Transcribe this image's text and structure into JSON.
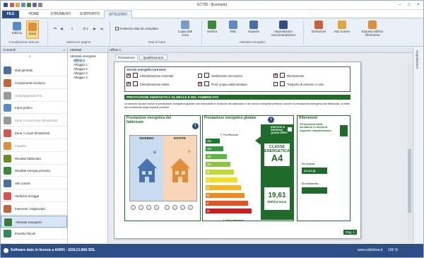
{
  "window": {
    "title": "EC700 - [Esempio]"
  },
  "ribbon_tabs": [
    "FILE",
    "HOME",
    "STRUMENTI",
    "SUPPORTO",
    "ATTESTATI"
  ],
  "ribbon": {
    "groups": [
      {
        "label": "Compilazione dati per"
      },
      {
        "label": "Selezione pagina"
      },
      {
        "label": "Dati di input"
      },
      {
        "label": "Attestati energetici"
      }
    ],
    "buttons": {
      "edificio": "Edificio",
      "zone": "Zone",
      "page_current": "1",
      "page_total": "di 4",
      "evidenzia": "Evidenzia dati da compilare",
      "copia": "Copia dati zona",
      "verifica": "Verifica",
      "xml": "XML",
      "esporta": "Esporta",
      "impostazioni": "Impostazioni raccomandazioni",
      "detrazioni": "Detrazioni",
      "atto": "Atto notorio",
      "esporta_edificio": "Esporta edificio riferimento"
    }
  },
  "side_panel": {
    "header": "Comandi",
    "items": [
      {
        "label": "Dati generali",
        "state": "normal",
        "color": "#4a6fa5"
      },
      {
        "label": "Componenti involucro",
        "state": "normal",
        "color": "#c9623b"
      },
      {
        "label": "Unità/appartamenti",
        "state": "dim",
        "color": "#9a9a9a"
      },
      {
        "label": "Input grafico",
        "state": "normal",
        "color": "#5a8ac9"
      },
      {
        "label": "Zone / Locali zone climatizzati",
        "state": "dim",
        "color": "#9a9a9a"
      },
      {
        "label": "Zone / Locali climatizzati",
        "state": "normal",
        "color": "#d9534f"
      },
      {
        "label": "Impianti",
        "state": "dim",
        "color": "#e08e3a"
      },
      {
        "label": "Risultati fabbricato",
        "state": "normal",
        "color": "#6b8e23"
      },
      {
        "label": "Risultati energia primaria",
        "state": "normal",
        "color": "#3a8a3a"
      },
      {
        "label": "Altri calcoli",
        "state": "normal",
        "color": "#4a6fa5"
      },
      {
        "label": "Verifiche di legge",
        "state": "normal",
        "color": "#d9534f"
      },
      {
        "label": "Interventi / Migliorativi",
        "state": "normal",
        "color": "#c9623b"
      },
      {
        "label": "Attestati energetici",
        "state": "selected",
        "color": "#3a7a3a"
      },
      {
        "label": "Incentivi fiscali",
        "state": "normal",
        "color": "#2e8b57"
      }
    ]
  },
  "tree_panel": {
    "header": "Attestati",
    "rows": [
      "Attestati energetici",
      "Ufficio 1",
      "Alloggio 1",
      "Alloggio 2",
      "Alloggio 3",
      "Alloggio 4"
    ]
  },
  "document": {
    "main_tab": "Ufficio 1",
    "subtabs": [
      "Prestazione",
      "Qualificazione"
    ],
    "right_rail": "Segnalazioni",
    "services": {
      "title": "Servizi energetici presenti",
      "items": [
        {
          "label": "Climatizzazione invernale",
          "checked": true
        },
        {
          "label": "Ventilazione meccanica",
          "checked": false
        },
        {
          "label": "Illuminazione",
          "checked": true
        },
        {
          "label": "Climatizzazione estiva",
          "checked": true
        },
        {
          "label": "Prod. acqua calda sanitaria",
          "checked": true
        },
        {
          "label": "Trasporto di persone o cose",
          "checked": false
        }
      ]
    },
    "section_title": "PRESTAZIONE ENERGETICA GLOBALE E DEL FABBRICATO",
    "description": "La sezione riporta l'indice di prestazione energetica globale non rinnovabile in funzione del fabbricato e dei servizi energetici presenti, nonché la prestazione energetica del fabbricato, al netto del rendimento degli impianti presenti.",
    "panel_fabbricato": {
      "title": "Prestazione energetica del fabbricato",
      "winter": "INVERNO",
      "summer": "ESTATE"
    },
    "panel_globale": {
      "title": "Prestazione energetica globale",
      "top_label": "Più efficiente",
      "bottom_label": "Meno efficiente",
      "nzeb": "EDIFICIO A ENERGIA QUASI ZERO",
      "class_label": "CLASSE ENERGETICA",
      "class_value": "A4",
      "index_value": "19,61",
      "index_unit": "kWh/m²anno",
      "classes": [
        {
          "name": "A4",
          "color": "#1a7a2e"
        },
        {
          "name": "A3",
          "color": "#2e9a3a"
        },
        {
          "name": "A2",
          "color": "#5cb83b"
        },
        {
          "name": "A1",
          "color": "#8cc63f"
        },
        {
          "name": "B",
          "color": "#c3d82f"
        },
        {
          "name": "C",
          "color": "#f0e020"
        },
        {
          "name": "D",
          "color": "#f6b51a"
        },
        {
          "name": "E",
          "color": "#ef8a1f"
        },
        {
          "name": "F",
          "color": "#e5531f"
        },
        {
          "name": "G",
          "color": "#d7191f"
        }
      ]
    },
    "panel_riferimenti": {
      "title": "Riferimenti",
      "text": "Gli immobili simili avrebbero in media la seguente classificazione:",
      "nuovo_label": "Se nuovo:",
      "nuovo_value": "A3 (11,8)",
      "esistente_label": "Se esistente:"
    },
    "page_number": "Pag. 1"
  },
  "status": {
    "license": "Software dato in licenza a A0001 - EDILCLIMA SRL",
    "site": "www.edilclima.it",
    "zoom": "100 %"
  }
}
